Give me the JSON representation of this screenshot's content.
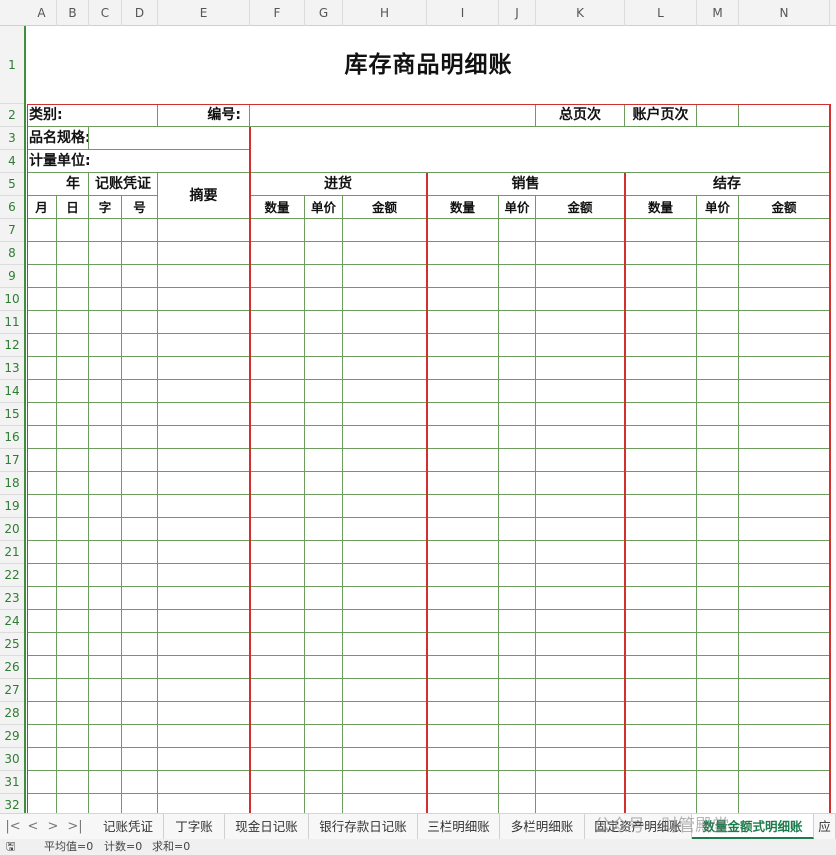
{
  "columns": [
    "A",
    "B",
    "C",
    "D",
    "E",
    "F",
    "G",
    "H",
    "I",
    "J",
    "K",
    "L",
    "M",
    "N"
  ],
  "rows": [
    "1",
    "2",
    "3",
    "4",
    "5",
    "6",
    "7",
    "8",
    "9",
    "10",
    "11",
    "12",
    "13",
    "14",
    "15",
    "16",
    "17",
    "18",
    "19",
    "20",
    "21",
    "22",
    "23",
    "24",
    "25",
    "26",
    "27",
    "28",
    "29",
    "30",
    "31",
    "32"
  ],
  "sheet": {
    "title": "库存商品明细账",
    "category_label": "类别:",
    "number_label": "编号:",
    "total_page_label": "总页次",
    "account_page_label": "账户页次",
    "name_spec_label": "品名规格:",
    "unit_label": "计量单位:",
    "year_label": "年",
    "voucher_label": "记账凭证",
    "summary_label": "摘要",
    "month_label": "月",
    "day_label": "日",
    "word_label": "字",
    "no_label": "号",
    "purchase_label": "进货",
    "sales_label": "销售",
    "balance_label": "结存",
    "qty_label": "数量",
    "price_label": "单价",
    "amount_label": "金额"
  },
  "tabs": [
    "记账凭证",
    "丁字账",
    "现金日记账",
    "银行存款日记账",
    "三栏明细账",
    "多栏明细账",
    "固定资产明细账",
    "数量金额式明细账",
    "应"
  ],
  "active_tab": "数量金额式明细账",
  "nav": {
    "first": "|<",
    "prev": "<",
    "next": ">",
    "last": ">|"
  },
  "watermark": "公众号 · 财管殿堂",
  "status": {
    "icon": "🖫",
    "average": "平均值=0",
    "count": "计数=0",
    "sum": "求和=0"
  }
}
